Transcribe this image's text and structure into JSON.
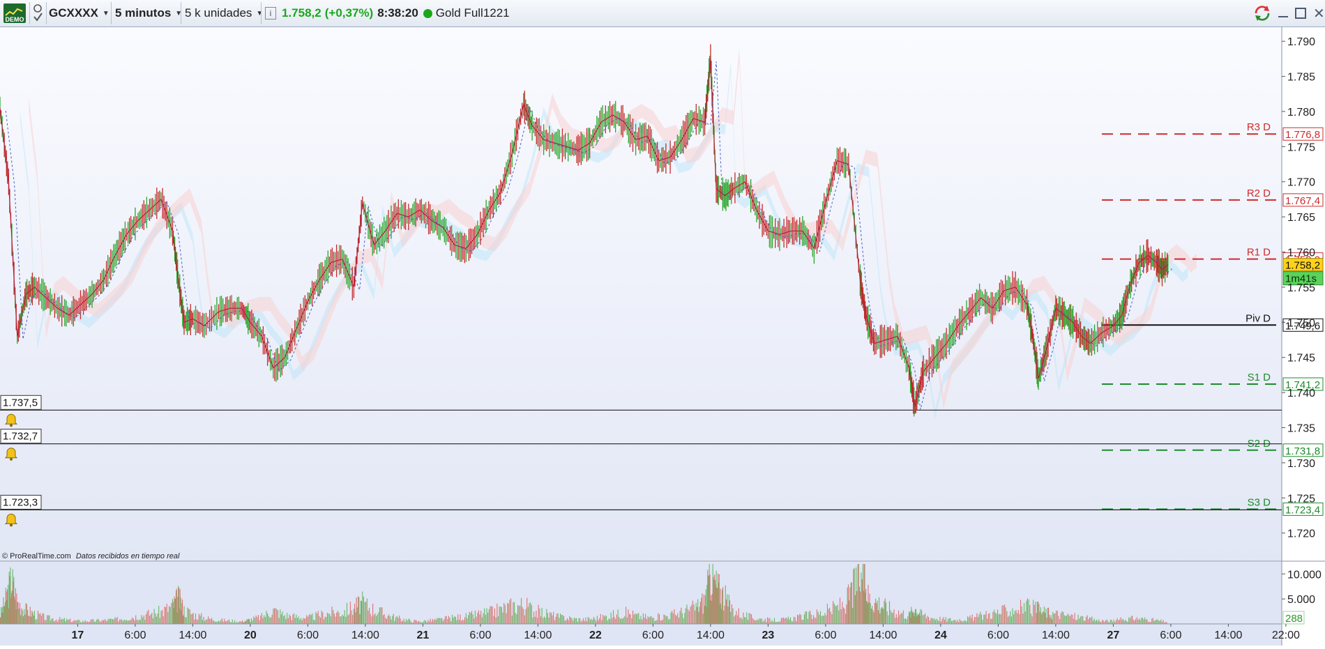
{
  "toolbar": {
    "demo_label": "DEMO",
    "symbol": "GCXXXX",
    "timeframe": "5 minutos",
    "units": "5 k unidades",
    "info_icon": "info-icon",
    "price": "1.758,2",
    "change": "(+0,37%)",
    "time": "8:38:20",
    "instrument": "Gold Full1221",
    "status_color": "#1aa81a",
    "window_buttons": [
      "refresh-icon",
      "minimize-icon",
      "maximize-icon",
      "close-icon"
    ]
  },
  "footer": {
    "copyright": "© ProRealTime.com",
    "realtime": "Datos recibidos en tiempo real"
  },
  "alerts": [
    {
      "price": 1737.5,
      "label": "1.737,5"
    },
    {
      "price": 1732.7,
      "label": "1.732,7"
    },
    {
      "price": 1723.3,
      "label": "1.723,3"
    }
  ],
  "pivots": [
    {
      "name": "R3 D",
      "value": 1776.8,
      "label": "1.776,8",
      "color": "#cc2b2b",
      "style": "dashed"
    },
    {
      "name": "R2 D",
      "value": 1767.4,
      "label": "1.767,4",
      "color": "#cc2b2b",
      "style": "dashed"
    },
    {
      "name": "R1 D",
      "value": 1759.0,
      "label": "1.759,0",
      "color": "#cc2b2b",
      "style": "dashed"
    },
    {
      "name": "Piv D",
      "value": 1749.6,
      "label": "1.749,6",
      "color": "#111111",
      "style": "solid"
    },
    {
      "name": "S1 D",
      "value": 1741.2,
      "label": "1.741,2",
      "color": "#1e8a2b",
      "style": "dashed"
    },
    {
      "name": "S2 D",
      "value": 1731.8,
      "label": "1.731,8",
      "color": "#1e8a2b",
      "style": "dashed"
    },
    {
      "name": "S3 D",
      "value": 1723.4,
      "label": "1.723,4",
      "color": "#1e8a2b",
      "style": "dashed"
    }
  ],
  "current_price": {
    "value": 1758.2,
    "label": "1.758,2",
    "timer": "1m41s"
  },
  "volume_current": "288",
  "chart_data": {
    "type": "line",
    "price_axis": {
      "ylim": [
        1716.0,
        1792.0
      ],
      "ticks": [
        1720,
        1725,
        1730,
        1735,
        1740,
        1745,
        1750,
        1755,
        1760,
        1765,
        1770,
        1775,
        1780,
        1785,
        1790
      ],
      "tick_labels": [
        "1.720",
        "1.725",
        "1.730",
        "1.735",
        "1.740",
        "1.745",
        "1.750",
        "1.755",
        "1.760",
        "1.765",
        "1.770",
        "1.775",
        "1.780",
        "1.785",
        "1.790"
      ]
    },
    "volume_axis": {
      "ylim": [
        0,
        12000
      ],
      "ticks": [
        5000,
        10000
      ],
      "tick_labels": [
        "5.000",
        "10.000"
      ]
    },
    "x_axis": {
      "range": [
        0,
        22
      ],
      "ticks": [
        {
          "x": 1.35,
          "label": "17",
          "bold": true
        },
        {
          "x": 2.35,
          "label": "6:00"
        },
        {
          "x": 3.35,
          "label": "14:00"
        },
        {
          "x": 4.35,
          "label": "20",
          "bold": true
        },
        {
          "x": 5.35,
          "label": "6:00"
        },
        {
          "x": 6.35,
          "label": "14:00"
        },
        {
          "x": 7.35,
          "label": "21",
          "bold": true
        },
        {
          "x": 8.35,
          "label": "6:00"
        },
        {
          "x": 9.35,
          "label": "14:00"
        },
        {
          "x": 10.35,
          "label": "22",
          "bold": true
        },
        {
          "x": 11.35,
          "label": "6:00"
        },
        {
          "x": 12.35,
          "label": "14:00"
        },
        {
          "x": 13.35,
          "label": "23",
          "bold": true
        },
        {
          "x": 14.35,
          "label": "6:00"
        },
        {
          "x": 15.35,
          "label": "14:00"
        },
        {
          "x": 16.35,
          "label": "24",
          "bold": true
        },
        {
          "x": 17.35,
          "label": "6:00"
        },
        {
          "x": 18.35,
          "label": "14:00"
        },
        {
          "x": 19.35,
          "label": "27",
          "bold": true
        },
        {
          "x": 20.35,
          "label": "6:00"
        },
        {
          "x": 21.35,
          "label": "14:00"
        },
        {
          "x": 22.35,
          "label": "22:00"
        }
      ]
    },
    "series": [
      {
        "values": [
          [
            0.0,
            1780.5
          ],
          [
            0.15,
            1770
          ],
          [
            0.3,
            1748
          ],
          [
            0.45,
            1754
          ],
          [
            0.6,
            1755
          ],
          [
            0.8,
            1753.5
          ],
          [
            1.0,
            1752
          ],
          [
            1.2,
            1751
          ],
          [
            1.4,
            1752.5
          ],
          [
            1.6,
            1754
          ],
          [
            1.8,
            1756
          ],
          [
            2.0,
            1759.5
          ],
          [
            2.2,
            1762.5
          ],
          [
            2.4,
            1764.5
          ],
          [
            2.6,
            1766
          ],
          [
            2.8,
            1767.5
          ],
          [
            3.0,
            1763
          ],
          [
            3.1,
            1756
          ],
          [
            3.2,
            1750
          ],
          [
            3.35,
            1750.5
          ],
          [
            3.55,
            1749.5
          ],
          [
            3.8,
            1751.5
          ],
          [
            4.0,
            1752
          ],
          [
            4.2,
            1752
          ],
          [
            4.35,
            1750
          ],
          [
            4.55,
            1748
          ],
          [
            4.75,
            1743.5
          ],
          [
            4.95,
            1745
          ],
          [
            5.15,
            1749
          ],
          [
            5.35,
            1753
          ],
          [
            5.55,
            1756
          ],
          [
            5.75,
            1758.5
          ],
          [
            5.95,
            1759
          ],
          [
            6.15,
            1755
          ],
          [
            6.3,
            1767
          ],
          [
            6.5,
            1761
          ],
          [
            6.7,
            1763
          ],
          [
            6.9,
            1765.5
          ],
          [
            7.1,
            1765
          ],
          [
            7.3,
            1766
          ],
          [
            7.5,
            1764.5
          ],
          [
            7.7,
            1763.5
          ],
          [
            7.9,
            1761
          ],
          [
            8.1,
            1760.5
          ],
          [
            8.3,
            1762.5
          ],
          [
            8.5,
            1766
          ],
          [
            8.7,
            1768.5
          ],
          [
            8.9,
            1774
          ],
          [
            9.1,
            1781
          ],
          [
            9.25,
            1778
          ],
          [
            9.45,
            1776
          ],
          [
            9.65,
            1775.5
          ],
          [
            9.85,
            1775
          ],
          [
            10.05,
            1774.5
          ],
          [
            10.25,
            1775.5
          ],
          [
            10.45,
            1778.5
          ],
          [
            10.65,
            1779.5
          ],
          [
            10.85,
            1778.5
          ],
          [
            11.05,
            1776
          ],
          [
            11.25,
            1776.5
          ],
          [
            11.45,
            1773
          ],
          [
            11.65,
            1773.5
          ],
          [
            11.85,
            1776
          ],
          [
            12.05,
            1779
          ],
          [
            12.25,
            1778.5
          ],
          [
            12.35,
            1787.5
          ],
          [
            12.45,
            1769
          ],
          [
            12.6,
            1768
          ],
          [
            12.75,
            1769
          ],
          [
            12.95,
            1770
          ],
          [
            13.15,
            1766
          ],
          [
            13.35,
            1763
          ],
          [
            13.55,
            1762.5
          ],
          [
            13.75,
            1763
          ],
          [
            13.95,
            1763
          ],
          [
            14.15,
            1760.5
          ],
          [
            14.35,
            1767
          ],
          [
            14.55,
            1773
          ],
          [
            14.75,
            1772.5
          ],
          [
            14.95,
            1756
          ],
          [
            15.05,
            1751
          ],
          [
            15.2,
            1747
          ],
          [
            15.4,
            1747.5
          ],
          [
            15.6,
            1748
          ],
          [
            15.8,
            1743.5
          ],
          [
            15.9,
            1738
          ],
          [
            16.05,
            1743
          ],
          [
            16.25,
            1745
          ],
          [
            16.45,
            1747
          ],
          [
            16.65,
            1749.5
          ],
          [
            16.85,
            1751.5
          ],
          [
            17.05,
            1753.5
          ],
          [
            17.25,
            1752
          ],
          [
            17.45,
            1754.5
          ],
          [
            17.65,
            1755
          ],
          [
            17.85,
            1752.5
          ],
          [
            17.95,
            1748
          ],
          [
            18.05,
            1742
          ],
          [
            18.2,
            1746.5
          ],
          [
            18.35,
            1752
          ],
          [
            18.5,
            1751
          ],
          [
            18.65,
            1750
          ],
          [
            18.8,
            1748
          ],
          [
            18.95,
            1747
          ],
          [
            19.15,
            1748.5
          ],
          [
            19.35,
            1749.5
          ],
          [
            19.5,
            1751
          ],
          [
            19.65,
            1755.5
          ],
          [
            19.8,
            1758.5
          ],
          [
            19.95,
            1759.5
          ],
          [
            20.1,
            1758.5
          ],
          [
            20.2,
            1757.5
          ],
          [
            20.3,
            1758.2
          ]
        ]
      }
    ],
    "volume": [
      [
        0.0,
        2000
      ],
      [
        0.1,
        6000
      ],
      [
        0.2,
        11000
      ],
      [
        0.3,
        5500
      ],
      [
        0.45,
        3500
      ],
      [
        0.6,
        2500
      ],
      [
        0.8,
        1500
      ],
      [
        1.0,
        1200
      ],
      [
        1.2,
        900
      ],
      [
        1.4,
        700
      ],
      [
        1.6,
        800
      ],
      [
        1.8,
        900
      ],
      [
        2.0,
        1100
      ],
      [
        2.2,
        1500
      ],
      [
        2.4,
        2000
      ],
      [
        2.6,
        2500
      ],
      [
        2.8,
        3000
      ],
      [
        3.0,
        4500
      ],
      [
        3.1,
        6500
      ],
      [
        3.2,
        3500
      ],
      [
        3.4,
        2200
      ],
      [
        3.6,
        1400
      ],
      [
        3.8,
        1000
      ],
      [
        4.0,
        800
      ],
      [
        4.2,
        600
      ],
      [
        4.35,
        1100
      ],
      [
        4.55,
        1800
      ],
      [
        4.75,
        3500
      ],
      [
        4.95,
        2200
      ],
      [
        5.15,
        1800
      ],
      [
        5.35,
        1500
      ],
      [
        5.55,
        2200
      ],
      [
        5.75,
        2800
      ],
      [
        5.95,
        3000
      ],
      [
        6.15,
        4200
      ],
      [
        6.3,
        5200
      ],
      [
        6.5,
        3600
      ],
      [
        6.7,
        2400
      ],
      [
        6.9,
        1500
      ],
      [
        7.1,
        900
      ],
      [
        7.3,
        600
      ],
      [
        7.5,
        900
      ],
      [
        7.7,
        1200
      ],
      [
        7.9,
        1600
      ],
      [
        8.1,
        1800
      ],
      [
        8.3,
        2400
      ],
      [
        8.5,
        2800
      ],
      [
        8.7,
        3600
      ],
      [
        8.9,
        4500
      ],
      [
        9.1,
        4800
      ],
      [
        9.3,
        3300
      ],
      [
        9.5,
        2500
      ],
      [
        9.7,
        1800
      ],
      [
        9.9,
        1400
      ],
      [
        10.1,
        1100
      ],
      [
        10.3,
        1300
      ],
      [
        10.5,
        1800
      ],
      [
        10.7,
        2400
      ],
      [
        10.9,
        2800
      ],
      [
        11.1,
        1900
      ],
      [
        11.3,
        1600
      ],
      [
        11.5,
        1800
      ],
      [
        11.7,
        2400
      ],
      [
        11.9,
        3100
      ],
      [
        12.1,
        4200
      ],
      [
        12.25,
        6000
      ],
      [
        12.35,
        12000
      ],
      [
        12.45,
        9500
      ],
      [
        12.55,
        7500
      ],
      [
        12.7,
        4200
      ],
      [
        12.9,
        2200
      ],
      [
        13.1,
        1500
      ],
      [
        13.3,
        1100
      ],
      [
        13.5,
        900
      ],
      [
        13.7,
        1200
      ],
      [
        13.9,
        1700
      ],
      [
        14.1,
        2300
      ],
      [
        14.3,
        2800
      ],
      [
        14.5,
        3900
      ],
      [
        14.7,
        5200
      ],
      [
        14.85,
        9500
      ],
      [
        15.0,
        12200
      ],
      [
        15.1,
        6500
      ],
      [
        15.25,
        5500
      ],
      [
        15.4,
        4200
      ],
      [
        15.6,
        3100
      ],
      [
        15.8,
        2200
      ],
      [
        15.9,
        4000
      ],
      [
        16.0,
        2500
      ],
      [
        16.2,
        1600
      ],
      [
        16.4,
        1200
      ],
      [
        16.6,
        1000
      ],
      [
        16.8,
        1300
      ],
      [
        17.0,
        1800
      ],
      [
        17.2,
        2500
      ],
      [
        17.4,
        3000
      ],
      [
        17.6,
        3600
      ],
      [
        17.8,
        4200
      ],
      [
        18.0,
        3800
      ],
      [
        18.15,
        3000
      ],
      [
        18.3,
        2600
      ],
      [
        18.5,
        2200
      ],
      [
        18.7,
        1800
      ],
      [
        18.9,
        1400
      ],
      [
        19.1,
        900
      ],
      [
        19.3,
        700
      ],
      [
        19.5,
        1100
      ],
      [
        19.7,
        1400
      ],
      [
        19.9,
        1200
      ],
      [
        20.1,
        900
      ],
      [
        20.3,
        500
      ]
    ]
  }
}
